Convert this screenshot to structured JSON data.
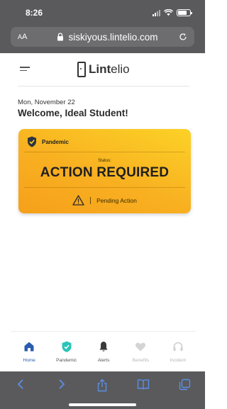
{
  "status_bar": {
    "time": "8:26"
  },
  "browser": {
    "text_size_label_small": "A",
    "text_size_label_large": "A",
    "url": "siskiyous.lintelio.com"
  },
  "app": {
    "brand_prefix": "Lint",
    "brand_suffix": "elio"
  },
  "greeting": {
    "date": "Mon, November 22",
    "welcome": "Welcome, Ideal Student!"
  },
  "card": {
    "category": "Pandemic",
    "status_label": "Status:",
    "status_value": "ACTION REQUIRED",
    "pending_text": "Pending Action",
    "colors": {
      "gradient_top": "#fcd226",
      "gradient_bottom": "#f6a01a"
    }
  },
  "tabs": [
    {
      "label": "Home",
      "icon": "home-icon"
    },
    {
      "label": "Pandemic",
      "icon": "shield-check-icon"
    },
    {
      "label": "Alerts",
      "icon": "bell-icon"
    },
    {
      "label": "Benefits",
      "icon": "heart-icon"
    },
    {
      "label": "Incident",
      "icon": "headset-icon"
    }
  ],
  "colors": {
    "active_tab": "#2a5db0",
    "pandemic_icon": "#2bc4b8",
    "browser_chrome": "#5a5a5c",
    "toolbar_icon": "#5b8fe6"
  }
}
